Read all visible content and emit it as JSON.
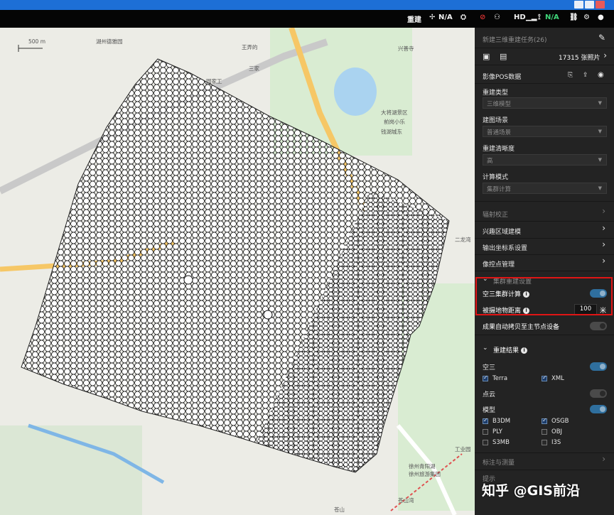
{
  "topbar": {
    "rebuild_label": "重建",
    "gps_status": "N/A",
    "hd_label": "HD",
    "signal_status": "N/A"
  },
  "map": {
    "scale_label": "500 m",
    "place_labels": [
      "湖州德雅园",
      "王弄的",
      "园家工",
      "三家",
      "兴善寺",
      "大将湖景区",
      "前岗小乐",
      "钱湖城东",
      "二龙湾",
      "徐州青阳湖",
      "徐州旅游集团",
      "苍山湾",
      "苍山",
      "工业园"
    ],
    "polygon": "camera-coverage"
  },
  "panel": {
    "task_title": "新建三维重建任务(26)",
    "photo_count": "17315 张照片",
    "pos_label": "影像POS数据",
    "reconstruction_type": {
      "label": "重建类型",
      "value": "三维模型"
    },
    "scene": {
      "label": "建图场景",
      "value": "普通场景"
    },
    "clarity": {
      "label": "重建清晰度",
      "value": "高"
    },
    "compute_mode": {
      "label": "计算模式",
      "value": "集群计算"
    },
    "radiometric": "辐射校正",
    "roi": "兴趣区域建模",
    "output_crs": "输出坐标系设置",
    "gcp": "像控点管理",
    "cluster_section": "集群重建设置",
    "aerial_cluster": "空三集群计算",
    "subject_distance": {
      "label": "被摄地物距离",
      "value": "100",
      "unit": "米"
    },
    "auto_copy": "成果自动拷贝至主节点设备",
    "results_header": "重建结果",
    "aerial": "空三",
    "terra": "Terra",
    "xml": "XML",
    "pointcloud": "点云",
    "model": "模型",
    "b3dm": "B3DM",
    "osgb": "OSGB",
    "ply": "PLY",
    "obj": "OBJ",
    "s3mb": "S3MB",
    "i3s": "I3S",
    "annotation": "标注与测量",
    "tips": "提示"
  },
  "watermark": "知乎 @GIS前沿",
  "colors": {
    "accent": "#2f6f9e",
    "highlight": "#e01515",
    "panel_bg": "#232323"
  }
}
